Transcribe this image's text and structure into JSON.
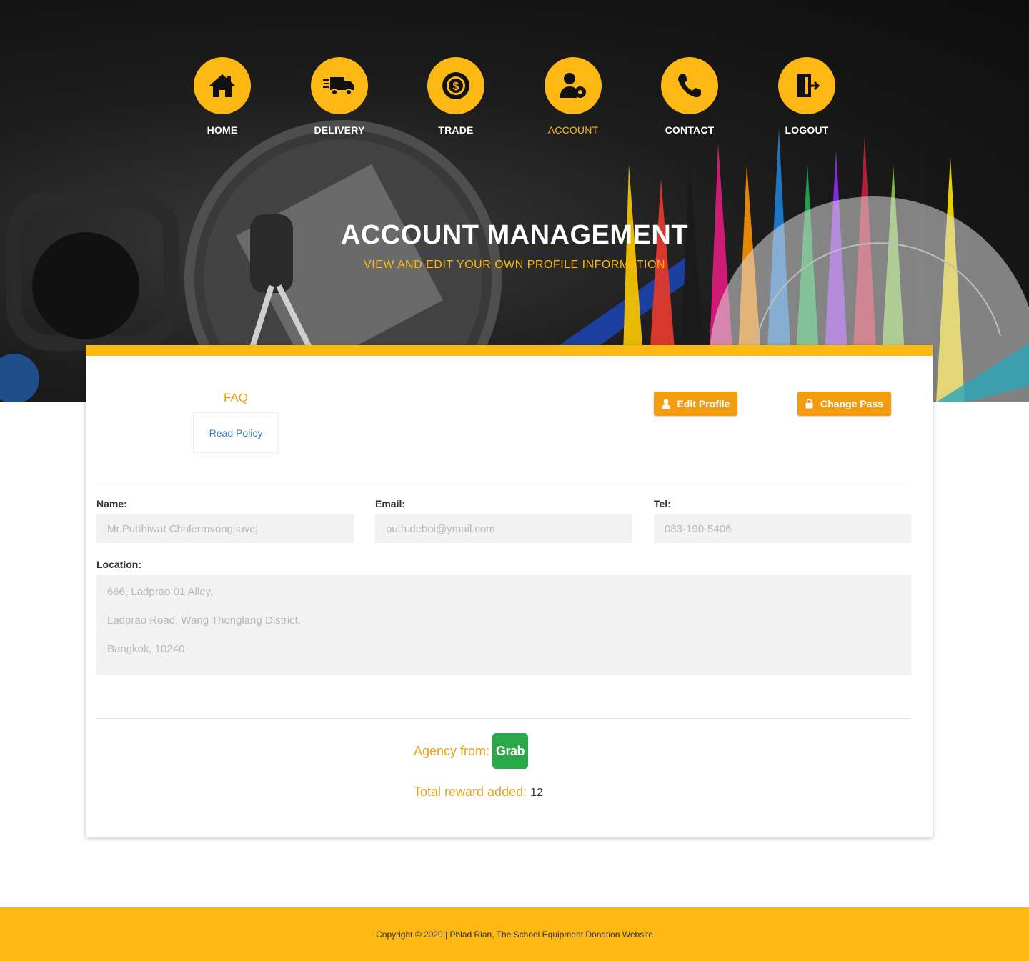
{
  "nav": {
    "items": [
      {
        "label": "HOME",
        "icon": "home-icon"
      },
      {
        "label": "DELIVERY",
        "icon": "delivery-truck-icon"
      },
      {
        "label": "TRADE",
        "icon": "dollar-badge-icon"
      },
      {
        "label": "ACCOUNT",
        "icon": "user-gear-icon",
        "active": true
      },
      {
        "label": "CONTACT",
        "icon": "phone-icon"
      },
      {
        "label": "LOGOUT",
        "icon": "door-exit-icon"
      }
    ]
  },
  "hero": {
    "title": "ACCOUNT MANAGEMENT",
    "subtitle": "VIEW AND EDIT YOUR OWN PROFILE INFORMATION"
  },
  "faq": {
    "title": "FAQ",
    "link": "-Read Policy-"
  },
  "buttons": {
    "edit_profile": "Edit Profile",
    "change_pass": "Change Pass"
  },
  "profile": {
    "name_label": "Name:",
    "name_value": "Mr.Putthiwat Chalermvongsavej",
    "email_label": "Email:",
    "email_value": "puth.deboi@ymail.com",
    "tel_label": "Tel:",
    "tel_value": "083-190-5406",
    "location_label": "Location:",
    "location_lines": [
      "666, Ladprao 01 Alley,",
      "Ladprao Road, Wang Thonglang District,",
      "Bangkok, 10240"
    ]
  },
  "agency": {
    "label": "Agency from:",
    "logo_text": "Grab"
  },
  "reward": {
    "label": "Total reward added:",
    "value": "12"
  },
  "footer": {
    "text": "Copyright © 2020 | Phlad Rian, The School Equipment Donation Website"
  },
  "colors": {
    "accent": "#fdb813",
    "button": "#f39c12",
    "label_orange": "#e8a317",
    "link_blue": "#3b7ac4",
    "grab_green": "#2ba84a"
  }
}
